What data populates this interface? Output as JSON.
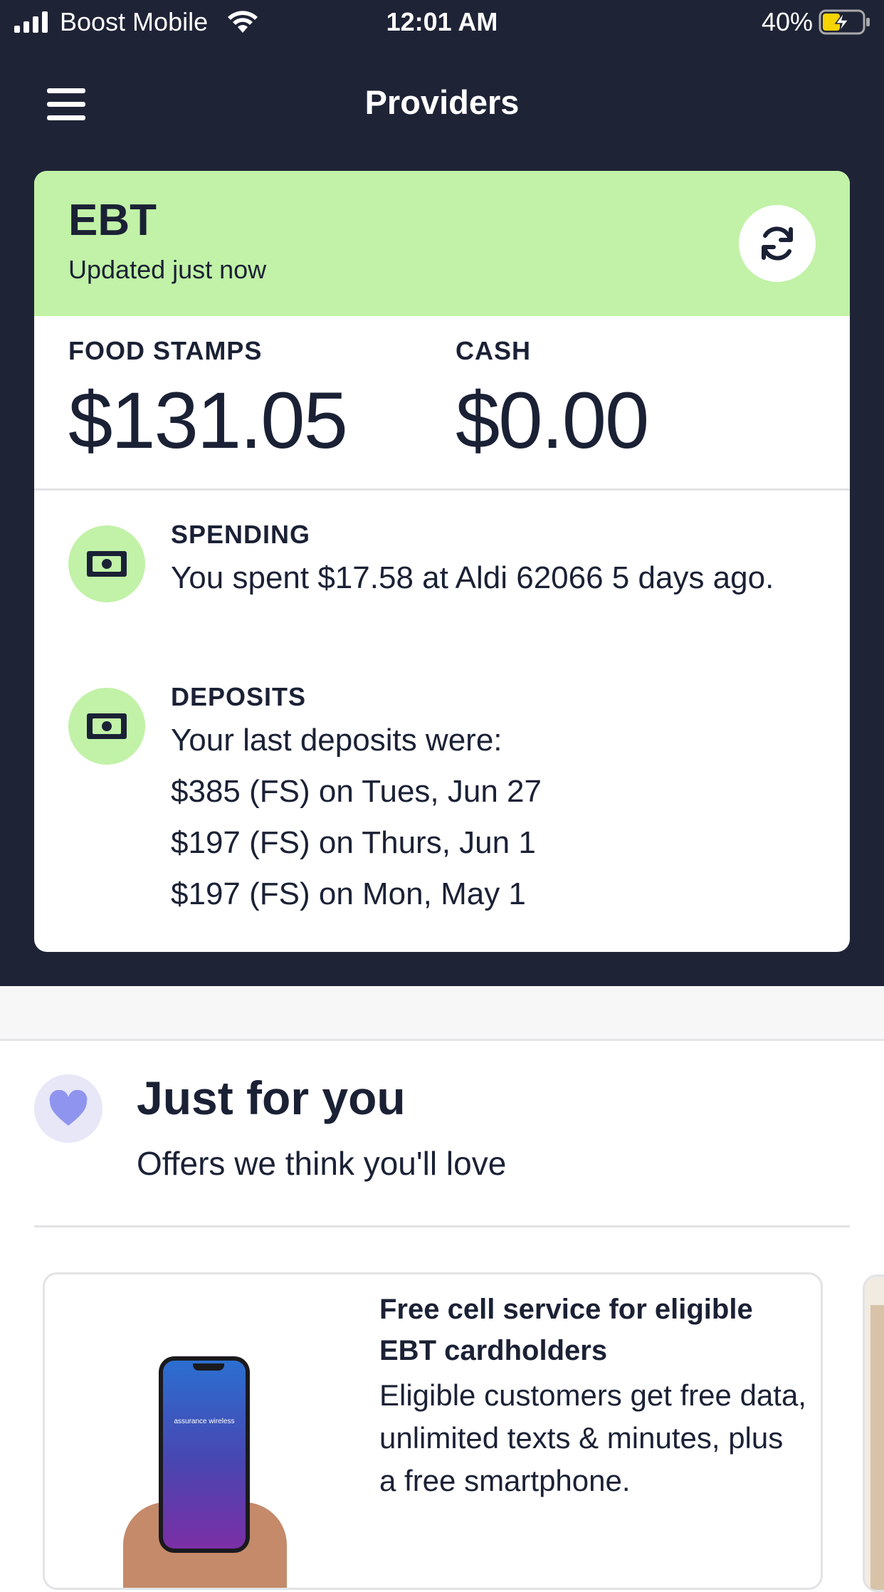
{
  "status_bar": {
    "carrier": "Boost Mobile",
    "time": "12:01 AM",
    "battery_percent": "40%",
    "icons": [
      "signal-icon",
      "wifi-icon",
      "battery-charging-icon"
    ]
  },
  "nav": {
    "title": "Providers",
    "menu_icon": "hamburger-menu-icon"
  },
  "ebt_card": {
    "title": "EBT",
    "updated": "Updated just now",
    "refresh_icon": "refresh-icon",
    "food_stamps_label": "FOOD STAMPS",
    "food_stamps_value": "$131.05",
    "cash_label": "CASH",
    "cash_value": "$0.00",
    "spending": {
      "label": "SPENDING",
      "text": "You spent $17.58 at Aldi 62066 5 days ago.",
      "icon": "cash-icon"
    },
    "deposits": {
      "label": "DEPOSITS",
      "intro": "Your last deposits were:",
      "items": [
        "$385 (FS) on Tues, Jun 27",
        "$197 (FS) on Thurs, Jun 1",
        "$197 (FS) on Mon, May 1"
      ],
      "icon": "cash-icon"
    }
  },
  "just_for_you": {
    "icon": "heart-icon",
    "title": "Just for you",
    "subtitle": "Offers we think you'll love"
  },
  "offer": {
    "title": "Free cell service for eligible EBT cardholders",
    "text": "Eligible customers get free data, unlimited texts & minutes, plus a free smartphone.",
    "image_brand": "assurance wireless"
  },
  "colors": {
    "navy": "#1f2336",
    "green_accent": "#c1f2a7",
    "lavender": "#e7e7f8",
    "heart": "#8f95ee"
  }
}
